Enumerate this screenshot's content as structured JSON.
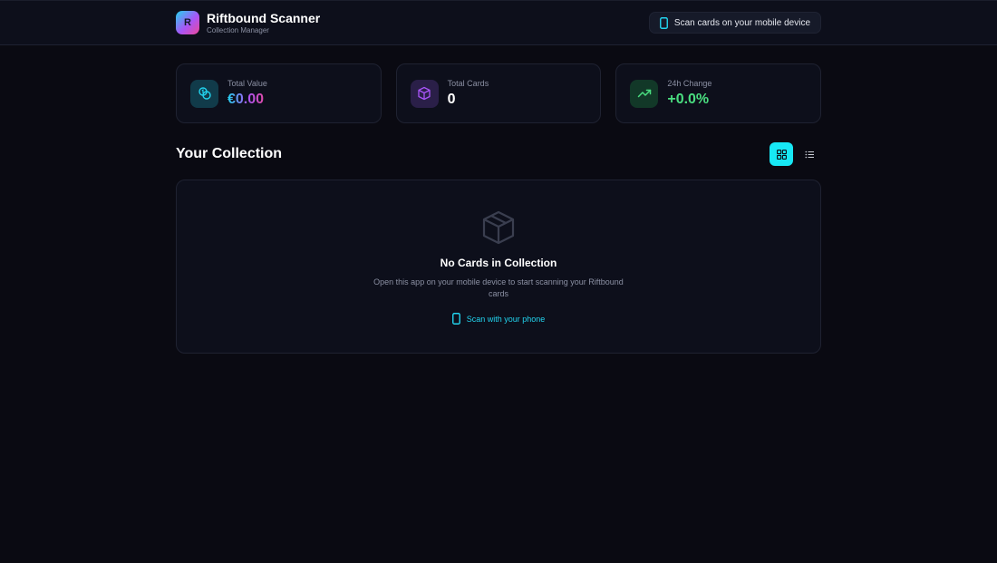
{
  "app": {
    "logo_letter": "R",
    "title": "Riftbound Scanner",
    "subtitle": "Collection Manager"
  },
  "header": {
    "scan_pill_label": "Scan cards on your mobile device"
  },
  "stats": [
    {
      "label": "Total Value",
      "value": "€0.00",
      "icon": "coins-icon"
    },
    {
      "label": "Total Cards",
      "value": "0",
      "icon": "cube-icon"
    },
    {
      "label": "24h Change",
      "value": "+0.0%",
      "icon": "trending-up-icon"
    }
  ],
  "collection": {
    "title": "Your Collection",
    "view_modes": [
      "grid",
      "list"
    ],
    "active_view": "grid"
  },
  "empty_state": {
    "icon": "package-icon",
    "title": "No Cards in Collection",
    "description": "Open this app on your mobile device to start scanning your Riftbound cards",
    "link_label": "Scan with your phone"
  },
  "colors": {
    "accent_cyan": "#22d3ee",
    "accent_purple": "#a855f7",
    "accent_pink": "#ec4899",
    "positive_green": "#4ade80",
    "background": "#0a0a12",
    "panel": "#0d0f1b"
  }
}
